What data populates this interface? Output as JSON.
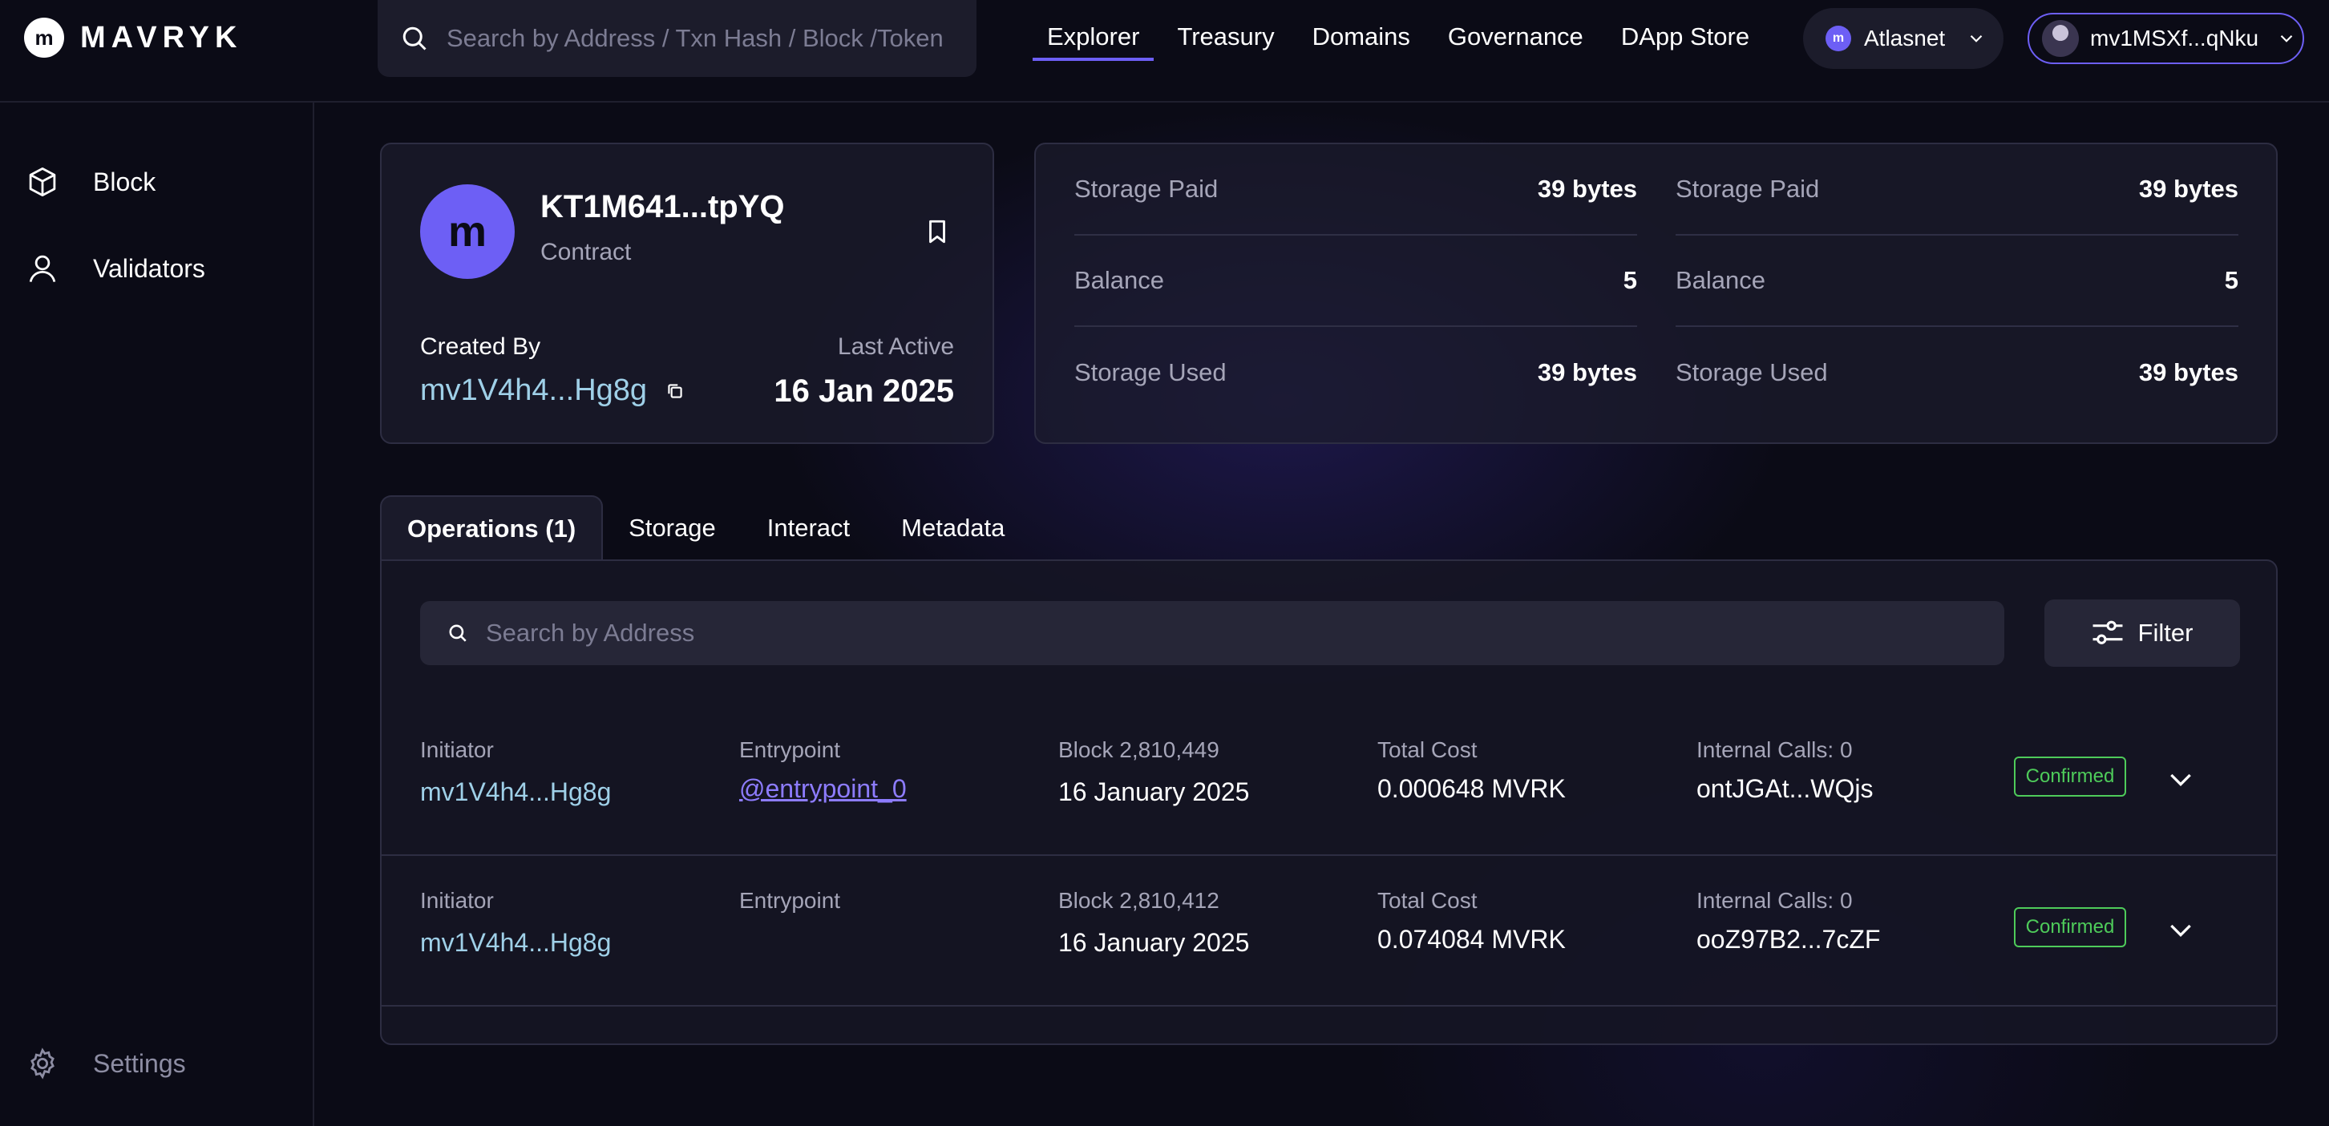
{
  "header": {
    "logo_text": "MAVRYK",
    "logo_mark": "m",
    "search_placeholder": "Search by Address / Txn Hash / Block /Token",
    "nav": [
      {
        "label": "Explorer",
        "active": true
      },
      {
        "label": "Treasury",
        "active": false
      },
      {
        "label": "Domains",
        "active": false
      },
      {
        "label": "Governance",
        "active": false
      },
      {
        "label": "DApp Store",
        "active": false
      }
    ],
    "network": {
      "label": "Atlasnet",
      "icon": "m"
    },
    "wallet": {
      "label": "mv1MSXf...qNku"
    }
  },
  "sidebar": {
    "items": [
      {
        "label": "Block",
        "icon": "cube-icon"
      },
      {
        "label": "Validators",
        "icon": "user-icon"
      }
    ],
    "settings_label": "Settings"
  },
  "profile": {
    "avatar_mark": "m",
    "name": "KT1M641...tpYQ",
    "type": "Contract",
    "created_by_label": "Created By",
    "created_by_value": "mv1V4h4...Hg8g",
    "last_active_label": "Last Active",
    "last_active_value": "16 Jan 2025"
  },
  "stats": {
    "columns": [
      [
        {
          "label": "Storage Paid",
          "value": "39 bytes"
        },
        {
          "label": "Balance",
          "value": "5"
        },
        {
          "label": "Storage Used",
          "value": "39 bytes"
        }
      ],
      [
        {
          "label": "Storage Paid",
          "value": "39 bytes"
        },
        {
          "label": "Balance",
          "value": "5"
        },
        {
          "label": "Storage Used",
          "value": "39 bytes"
        }
      ]
    ]
  },
  "tabs": [
    {
      "label": "Operations (1)",
      "active": true
    },
    {
      "label": "Storage",
      "active": false
    },
    {
      "label": "Interact",
      "active": false
    },
    {
      "label": "Metadata",
      "active": false
    }
  ],
  "operations": {
    "search_placeholder": "Search by Address",
    "filter_label": "Filter",
    "rows": [
      {
        "initiator_label": "Initiator",
        "initiator_value": "mv1V4h4...Hg8g",
        "entrypoint_label": "Entrypoint",
        "entrypoint_value": "@entrypoint_0",
        "block_label": "Block 2,810,449",
        "block_date": "16 January 2025",
        "cost_label": "Total Cost",
        "cost_value": "0.000648 MVRK",
        "calls_label": "Internal Calls: 0",
        "hash": "ontJGAt...WQjs",
        "status": "Confirmed"
      },
      {
        "initiator_label": "Initiator",
        "initiator_value": "mv1V4h4...Hg8g",
        "entrypoint_label": "Entrypoint",
        "entrypoint_value": "",
        "block_label": "Block 2,810,412",
        "block_date": "16 January 2025",
        "cost_label": "Total Cost",
        "cost_value": "0.074084 MVRK",
        "calls_label": "Internal Calls: 0",
        "hash": "ooZ97B2...7cZF",
        "status": "Confirmed"
      }
    ]
  },
  "colors": {
    "accent": "#6d5ff5",
    "link": "#9fd0e8",
    "confirmed": "#4ecb5a",
    "background": "#0b0b16"
  }
}
